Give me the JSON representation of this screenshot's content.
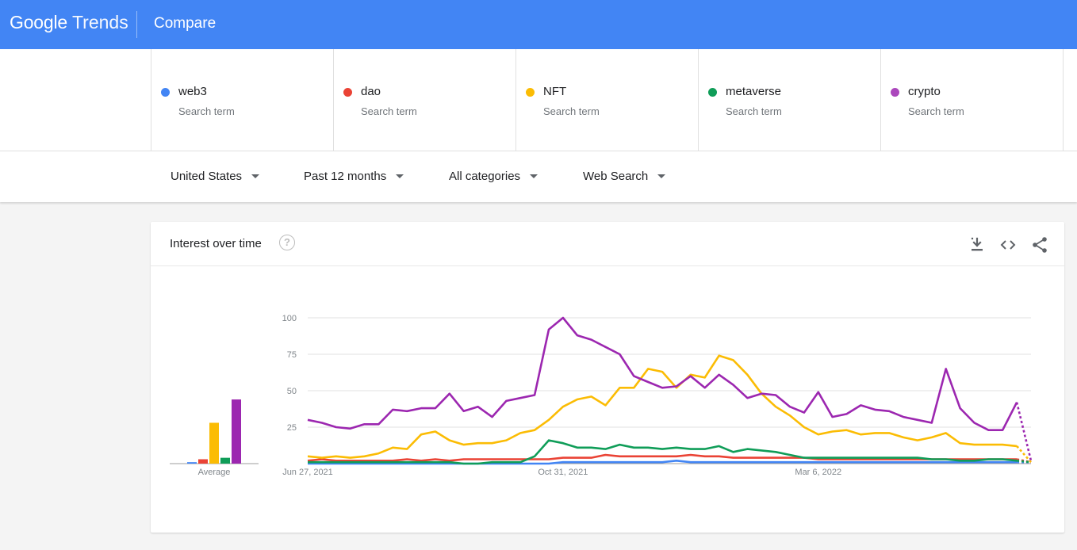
{
  "header": {
    "brand": "Google",
    "product": "Trends",
    "title": "Compare"
  },
  "terms": [
    {
      "name": "web3",
      "sub": "Search term",
      "color": "#4285f4"
    },
    {
      "name": "dao",
      "sub": "Search term",
      "color": "#ea4335"
    },
    {
      "name": "NFT",
      "sub": "Search term",
      "color": "#fbbc04"
    },
    {
      "name": "metaverse",
      "sub": "Search term",
      "color": "#0f9d58"
    },
    {
      "name": "crypto",
      "sub": "Search term",
      "color": "#ab47bc"
    }
  ],
  "filters": {
    "region": "United States",
    "time": "Past 12 months",
    "category": "All categories",
    "search_type": "Web Search"
  },
  "card": {
    "title": "Interest over time",
    "help": "?",
    "download_icon": "download-icon",
    "embed_icon": "embed-code-icon",
    "share_icon": "share-icon"
  },
  "chart_data": {
    "type": "line",
    "ylim": [
      0,
      100
    ],
    "yticks": [
      25,
      50,
      75,
      100
    ],
    "x_tick_labels": [
      "Jun 27, 2021",
      "Oct 31, 2021",
      "Mar 6, 2022"
    ],
    "x_tick_index": [
      0,
      18,
      36
    ],
    "x": [
      "Jun 27, 2021",
      "Jul 4, 2021",
      "Jul 11, 2021",
      "Jul 18, 2021",
      "Jul 25, 2021",
      "Aug 1, 2021",
      "Aug 8, 2021",
      "Aug 15, 2021",
      "Aug 22, 2021",
      "Aug 29, 2021",
      "Sep 5, 2021",
      "Sep 12, 2021",
      "Sep 19, 2021",
      "Sep 26, 2021",
      "Oct 3, 2021",
      "Oct 10, 2021",
      "Oct 17, 2021",
      "Oct 24, 2021",
      "Oct 31, 2021",
      "Nov 7, 2021",
      "Nov 14, 2021",
      "Nov 21, 2021",
      "Nov 28, 2021",
      "Dec 5, 2021",
      "Dec 12, 2021",
      "Dec 19, 2021",
      "Dec 26, 2021",
      "Jan 2, 2022",
      "Jan 9, 2022",
      "Jan 16, 2022",
      "Jan 23, 2022",
      "Jan 30, 2022",
      "Feb 6, 2022",
      "Feb 13, 2022",
      "Feb 20, 2022",
      "Feb 27, 2022",
      "Mar 6, 2022",
      "Mar 13, 2022",
      "Mar 20, 2022",
      "Mar 27, 2022",
      "Apr 3, 2022",
      "Apr 10, 2022",
      "Apr 17, 2022",
      "Apr 24, 2022",
      "May 1, 2022",
      "May 8, 2022",
      "May 15, 2022",
      "May 22, 2022",
      "May 29, 2022",
      "Jun 5, 2022",
      "Jun 12, 2022",
      "Jun 19, 2022"
    ],
    "partial_from_index": 50,
    "series": [
      {
        "name": "web3",
        "color": "#4285f4",
        "values": [
          0,
          0,
          0,
          0,
          0,
          0,
          0,
          0,
          0,
          0,
          0,
          0,
          0,
          0,
          0,
          0,
          0,
          0,
          1,
          1,
          1,
          1,
          1,
          1,
          1,
          1,
          2,
          1,
          1,
          1,
          1,
          1,
          1,
          1,
          1,
          1,
          1,
          1,
          1,
          1,
          1,
          1,
          1,
          1,
          1,
          1,
          1,
          1,
          1,
          1,
          1,
          1
        ],
        "average": 1
      },
      {
        "name": "dao",
        "color": "#ea4335",
        "values": [
          2,
          3,
          2,
          2,
          2,
          2,
          2,
          3,
          2,
          3,
          2,
          3,
          3,
          3,
          3,
          3,
          3,
          3,
          4,
          4,
          4,
          6,
          5,
          5,
          5,
          5,
          5,
          6,
          5,
          5,
          4,
          4,
          4,
          4,
          4,
          4,
          3,
          3,
          3,
          3,
          3,
          3,
          3,
          3,
          3,
          3,
          3,
          3,
          3,
          3,
          3,
          1
        ],
        "average": 3
      },
      {
        "name": "NFT",
        "color": "#fbbc04",
        "values": [
          5,
          4,
          5,
          4,
          5,
          7,
          11,
          10,
          20,
          22,
          16,
          13,
          14,
          14,
          16,
          21,
          23,
          30,
          39,
          44,
          46,
          40,
          52,
          52,
          65,
          63,
          52,
          61,
          59,
          74,
          71,
          61,
          48,
          39,
          33,
          25,
          20,
          22,
          23,
          20,
          21,
          21,
          18,
          16,
          18,
          21,
          14,
          13,
          13,
          13,
          12,
          1
        ],
        "average": 28
      },
      {
        "name": "metaverse",
        "color": "#0f9d58",
        "values": [
          1,
          1,
          1,
          1,
          1,
          1,
          1,
          1,
          1,
          1,
          1,
          0,
          0,
          1,
          1,
          1,
          5,
          16,
          14,
          11,
          11,
          10,
          13,
          11,
          11,
          10,
          11,
          10,
          10,
          12,
          8,
          10,
          9,
          8,
          6,
          4,
          4,
          4,
          4,
          4,
          4,
          4,
          4,
          4,
          3,
          3,
          2,
          2,
          3,
          3,
          2,
          1
        ],
        "average": 4
      },
      {
        "name": "crypto",
        "color": "#9c27b0",
        "values": [
          30,
          28,
          25,
          24,
          27,
          27,
          37,
          36,
          38,
          38,
          48,
          36,
          39,
          32,
          43,
          45,
          47,
          92,
          100,
          88,
          85,
          80,
          75,
          60,
          56,
          52,
          53,
          60,
          52,
          61,
          54,
          45,
          48,
          47,
          39,
          35,
          49,
          32,
          34,
          40,
          37,
          36,
          32,
          30,
          28,
          65,
          38,
          28,
          23,
          23,
          42,
          2
        ],
        "average": 44
      }
    ],
    "average_label": "Average"
  }
}
